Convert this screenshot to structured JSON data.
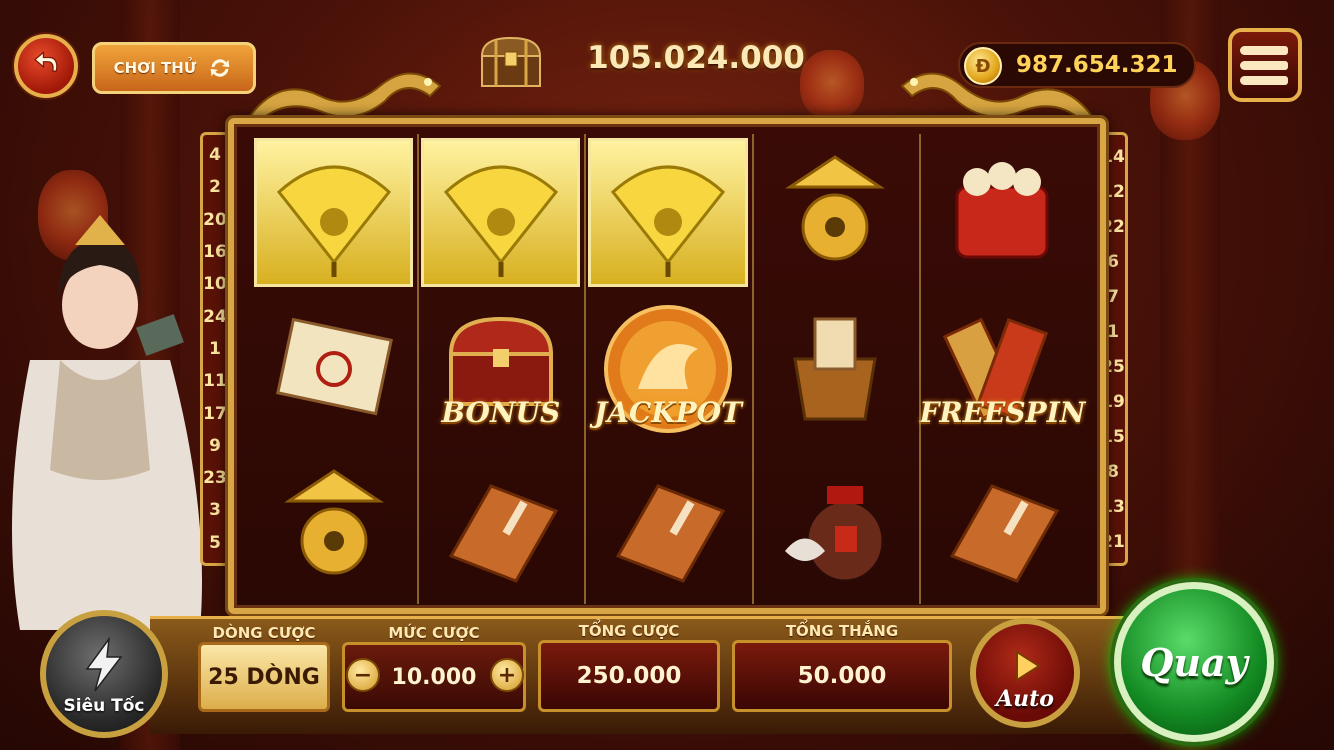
{
  "header": {
    "demo_label": "CHƠI THỬ",
    "jackpot_value": "105.024.000",
    "balance": "987.654.321",
    "coin_symbol": "Đ"
  },
  "paylines": {
    "left": [
      "4",
      "2",
      "20",
      "16",
      "10",
      "24",
      "1",
      "11",
      "17",
      "9",
      "23",
      "3",
      "5"
    ],
    "right": [
      "14",
      "12",
      "22",
      "6",
      "7",
      "1",
      "25",
      "19",
      "15",
      "8",
      "13",
      "21"
    ]
  },
  "reels": [
    {
      "symbol": "fan-icon",
      "label": "",
      "win": true
    },
    {
      "symbol": "fan-icon",
      "label": "",
      "win": true
    },
    {
      "symbol": "fan-icon",
      "label": "",
      "win": true
    },
    {
      "symbol": "gourd-hat-icon",
      "label": "",
      "win": false
    },
    {
      "symbol": "firecracker-icon",
      "label": "",
      "win": false
    },
    {
      "symbol": "scroll-icon",
      "label": "",
      "win": false
    },
    {
      "symbol": "treasure-chest-icon",
      "label": "BONUS",
      "win": false
    },
    {
      "symbol": "dragon-coin-icon",
      "label": "JACKPOT",
      "win": false
    },
    {
      "symbol": "bucket-scroll-icon",
      "label": "",
      "win": false
    },
    {
      "symbol": "talisman-icon",
      "label": "FREESPIN",
      "win": false
    },
    {
      "symbol": "gourd-hat-icon",
      "label": "",
      "win": false
    },
    {
      "symbol": "book-icon",
      "label": "",
      "win": false
    },
    {
      "symbol": "book-icon",
      "label": "",
      "win": false
    },
    {
      "symbol": "wine-jar-icon",
      "label": "",
      "win": false
    },
    {
      "symbol": "book-icon",
      "label": "",
      "win": false
    }
  ],
  "controls": {
    "turbo_label": "Siêu Tốc",
    "lines_title": "DÒNG CƯỢC",
    "lines_value": "25 DÒNG",
    "bet_title": "MỨC CƯỢC",
    "bet_value": "10.000",
    "minus": "−",
    "plus": "+",
    "total_bet_title": "TỔNG CƯỢC",
    "total_bet_value": "250.000",
    "total_win_title": "TỔNG THẮNG",
    "total_win_value": "50.000",
    "auto_label": "Auto",
    "spin_label": "Quay"
  },
  "colors": {
    "gold": "#d9a645",
    "win_highlight": "#f0d040",
    "spin_green": "#1a9a2a",
    "balance_yellow": "#ffd35a"
  }
}
